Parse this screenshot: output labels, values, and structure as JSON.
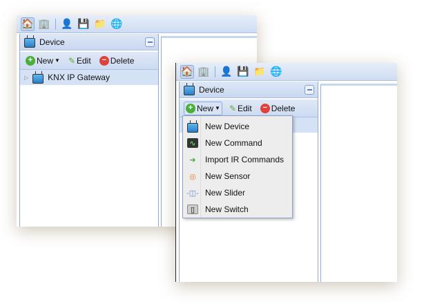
{
  "toolbar": {
    "icons": [
      "home-icon",
      "building-icon",
      "user-icon",
      "save-icon",
      "folder-icon",
      "globe-icon"
    ]
  },
  "panel": {
    "title": "Device"
  },
  "actions": {
    "new": "New",
    "edit": "Edit",
    "delete": "Delete"
  },
  "tree": {
    "items": [
      {
        "label": "KNX IP Gateway"
      }
    ]
  },
  "new_menu": {
    "items": [
      {
        "label": "New Device",
        "icon": "tv-icon"
      },
      {
        "label": "New Command",
        "icon": "command-icon"
      },
      {
        "label": "Import IR Commands",
        "icon": "import-icon"
      },
      {
        "label": "New Sensor",
        "icon": "sensor-icon"
      },
      {
        "label": "New Slider",
        "icon": "slider-icon"
      },
      {
        "label": "New Switch",
        "icon": "switch-icon"
      }
    ]
  },
  "colors": {
    "panel_blue": "#cfdcf1",
    "border_blue": "#8eaadb",
    "selected_row": "#d5e2f6"
  }
}
